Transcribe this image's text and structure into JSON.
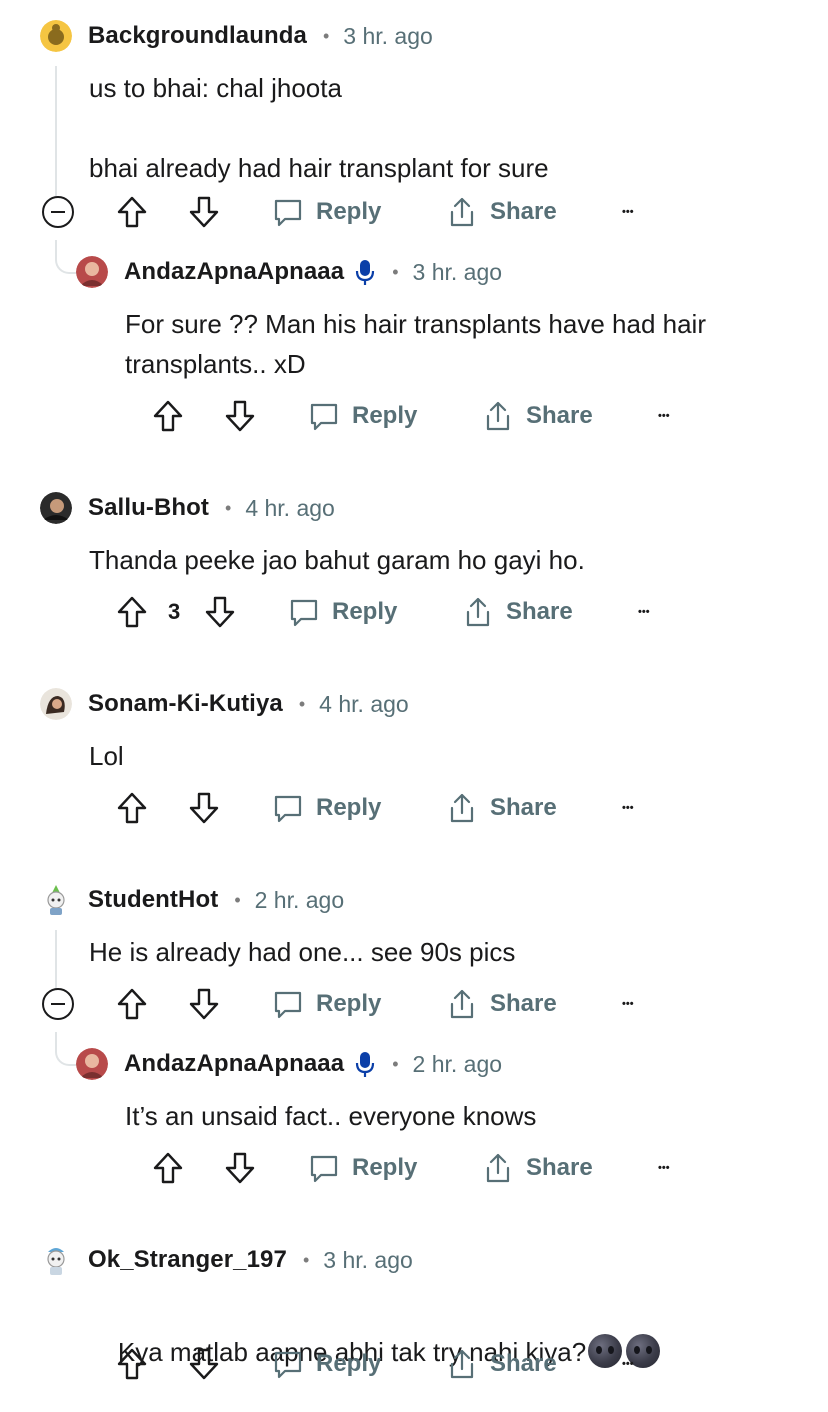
{
  "comments": [
    {
      "username": "Backgroundlaunda",
      "sep": "•",
      "time": "3 hr. ago",
      "body": "us to bhai: chal jhoota\n\nbhai already had hair transplant for sure",
      "reply": "Reply",
      "share": "Share",
      "more": "•••"
    },
    {
      "username": "AndazApnaApnaaa",
      "sep": "•",
      "time": "3 hr. ago",
      "body": "For sure ?? Man his hair transplants have had hair transplants.. xD",
      "reply": "Reply",
      "share": "Share",
      "more": "•••"
    },
    {
      "username": "Sallu-Bhot",
      "sep": "•",
      "time": "4 hr. ago",
      "body": "Thanda peeke jao bahut garam ho gayi ho.",
      "votes": "3",
      "reply": "Reply",
      "share": "Share",
      "more": "•••"
    },
    {
      "username": "Sonam-Ki-Kutiya",
      "sep": "•",
      "time": "4 hr. ago",
      "body": "Lol",
      "reply": "Reply",
      "share": "Share",
      "more": "•••"
    },
    {
      "username": "StudentHot",
      "sep": "•",
      "time": "2 hr. ago",
      "body": "He is already had one... see 90s pics",
      "reply": "Reply",
      "share": "Share",
      "more": "•••"
    },
    {
      "username": "AndazApnaApnaaa",
      "sep": "•",
      "time": "2 hr. ago",
      "body": "It’s an unsaid fact.. everyone knows",
      "reply": "Reply",
      "share": "Share",
      "more": "•••"
    },
    {
      "username": "Ok_Stranger_197",
      "sep": "•",
      "time": "3 hr. ago",
      "body": "Kya matlab aapne abhi tak try nahi kiya?",
      "emoji": [
        "new-moon-face",
        "new-moon-face"
      ],
      "reply": "Reply",
      "share": "Share",
      "more": "•••"
    }
  ],
  "colors": {
    "text": "#1a1a1b",
    "meta": "#576f76",
    "thread_line": "#e0e4e6",
    "mic_badge": "#0b3fa8"
  }
}
